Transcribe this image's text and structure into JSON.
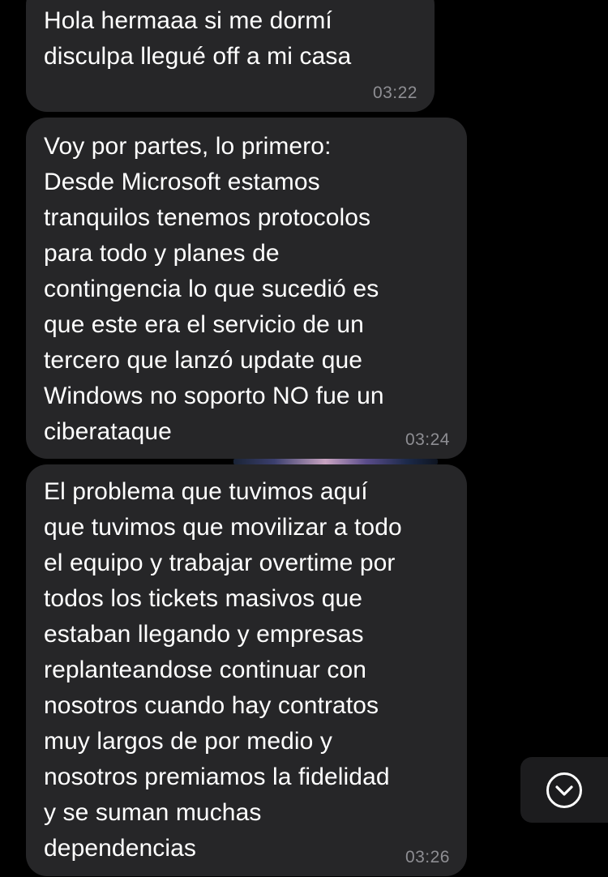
{
  "messages": [
    {
      "text": "Hola hermaaa si me dormí\ndisculpa llegué off a mi casa",
      "time": "03:22"
    },
    {
      "text": "Voy por partes, lo primero:\nDesde Microsoft estamos\ntranquilos tenemos protocolos\npara todo y planes de\ncontingencia lo que sucedió es\nque este era el servicio de un\ntercero que lanzó update que\nWindows no soporto NO fue un\nciberataque",
      "time": "03:24"
    },
    {
      "text": "El problema que tuvimos aquí\nque tuvimos que movilizar a todo\nel equipo y trabajar overtime por\ntodos los tickets masivos que\nestaban llegando y empresas\nreplanteandose continuar con\nnosotros cuando hay contratos\nmuy largos de por medio y\nnosotros premiamos la fidelidad\ny se suman muchas\ndependencias",
      "time": "03:26"
    }
  ],
  "scroll_button": {
    "icon": "chevron-down-circle-icon"
  },
  "colors": {
    "background": "#000000",
    "bubble": "#262628",
    "text": "#ffffff",
    "timestamp": "#8e8e93"
  }
}
